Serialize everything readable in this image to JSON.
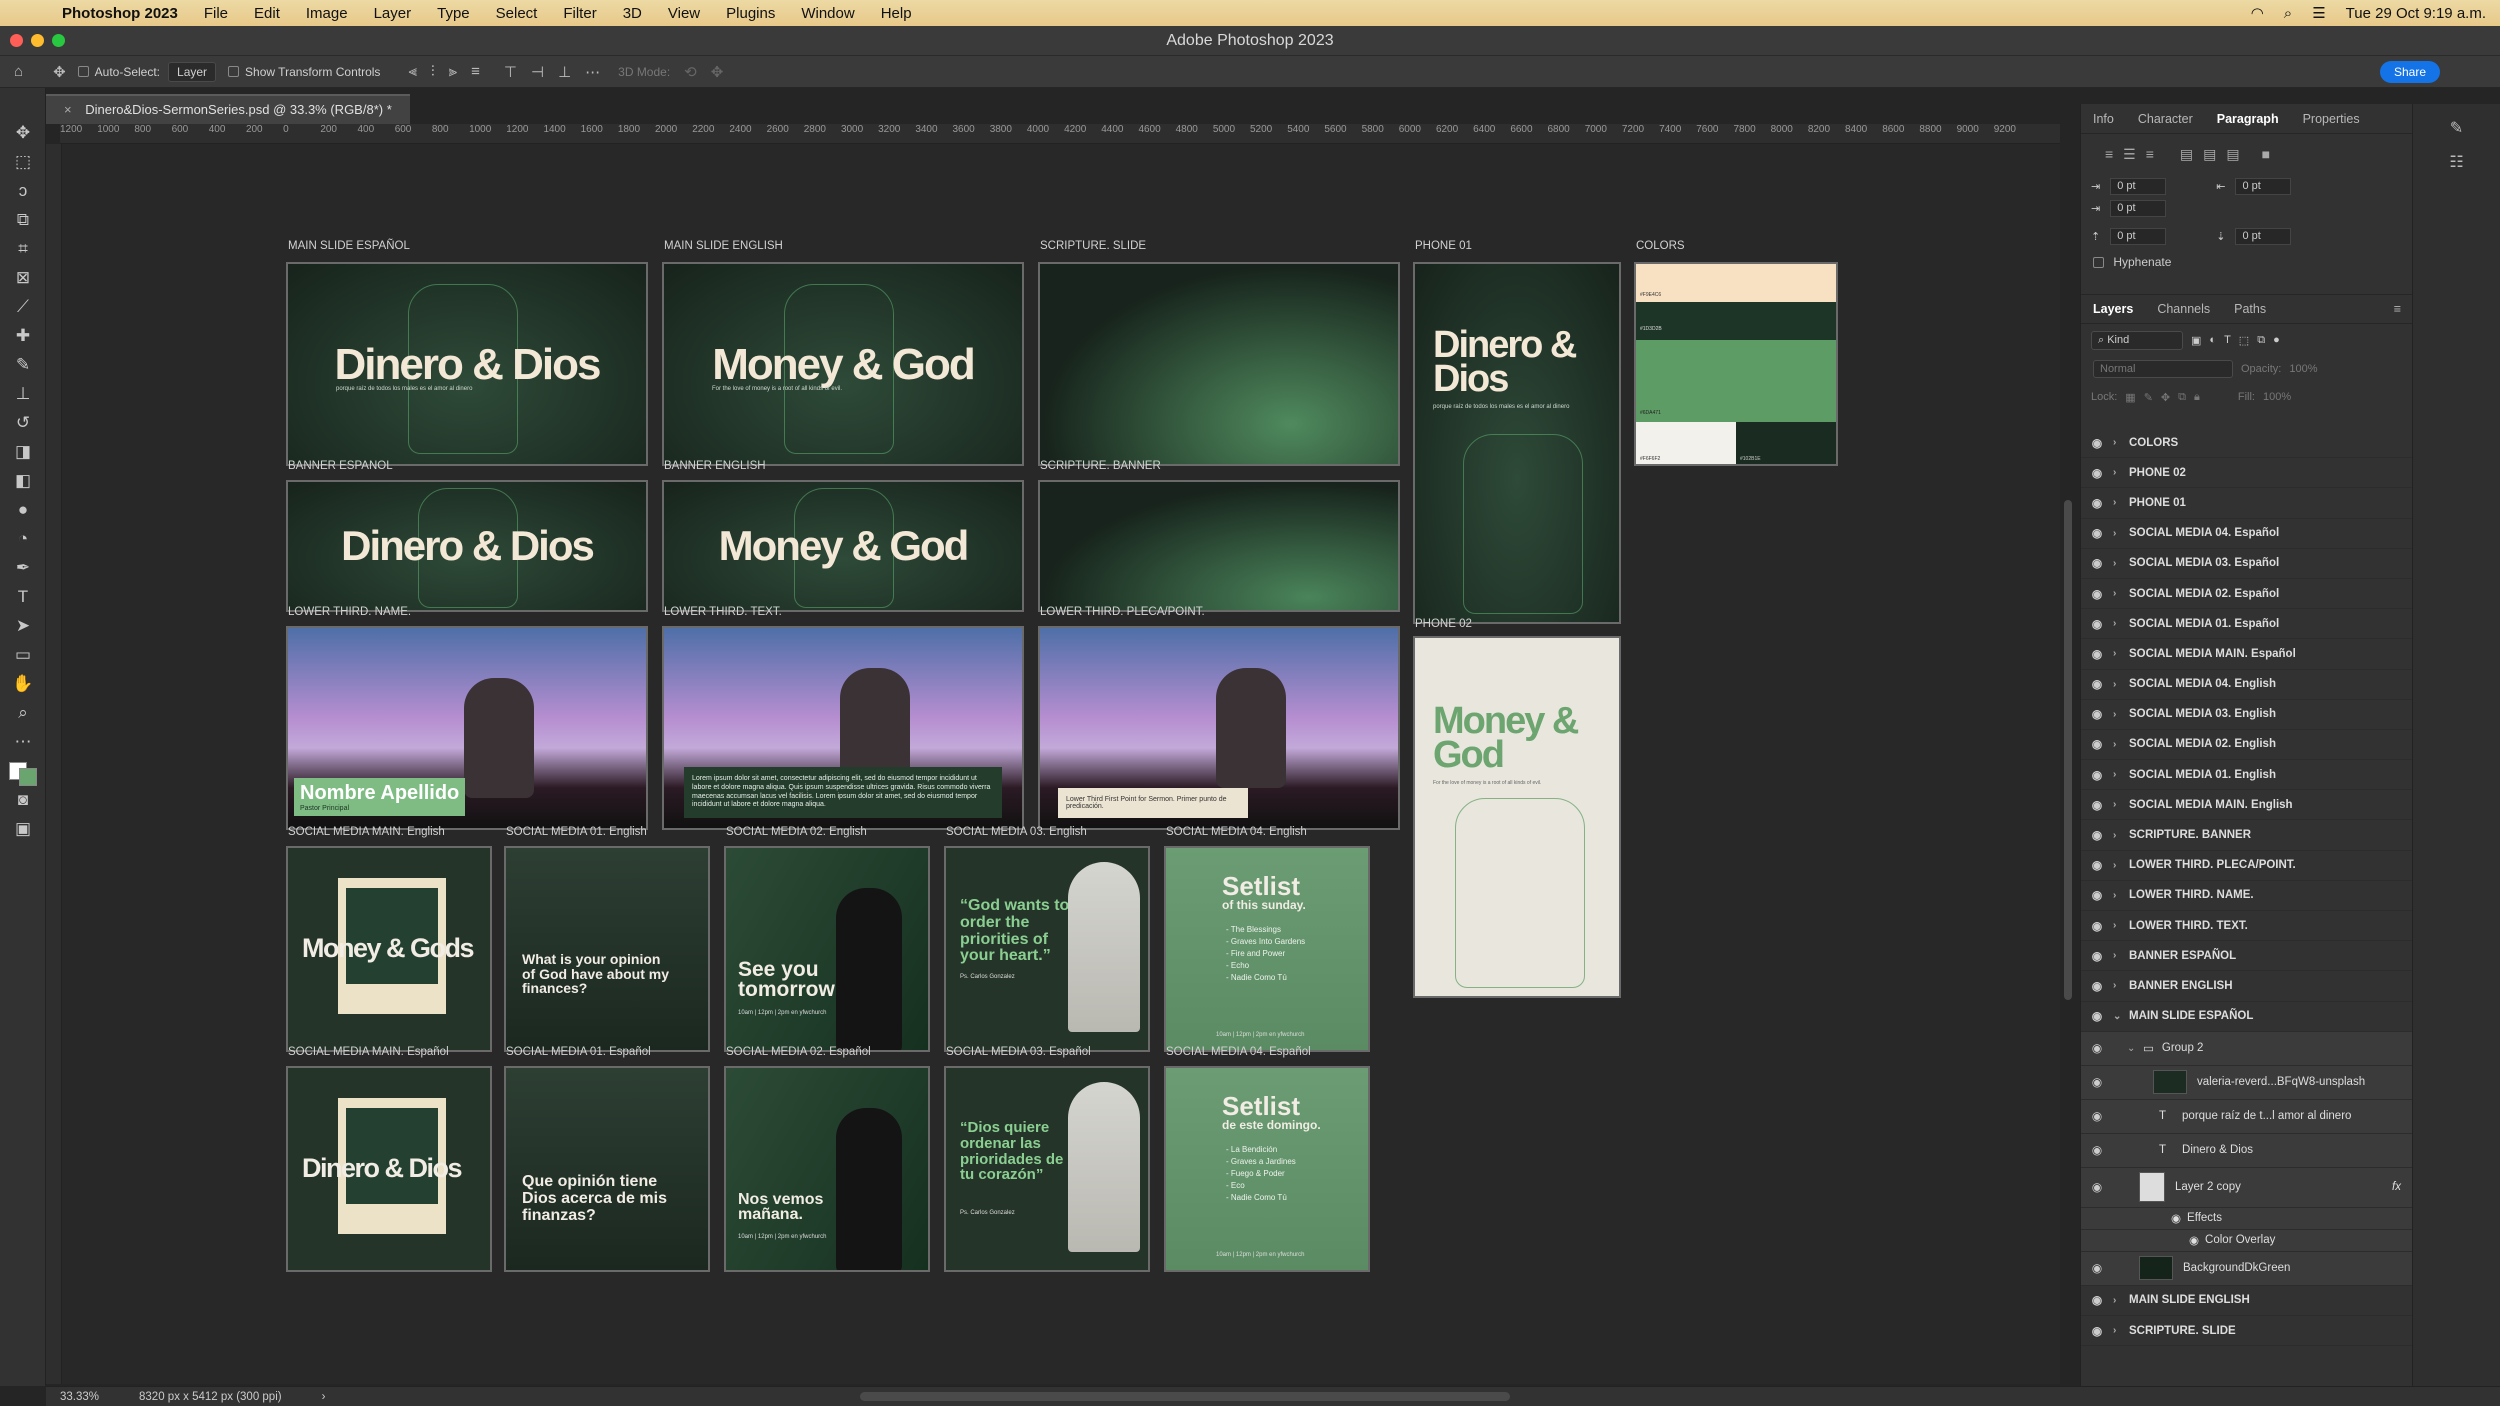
{
  "menubar": {
    "app": "Photoshop 2023",
    "items": [
      "File",
      "Edit",
      "Image",
      "Layer",
      "Type",
      "Select",
      "Filter",
      "3D",
      "View",
      "Plugins",
      "Window",
      "Help"
    ],
    "datetime": "Tue 29 Oct  9:19 a.m."
  },
  "window": {
    "title": "Adobe Photoshop 2023"
  },
  "options": {
    "auto_select_label": "Auto-Select:",
    "auto_select_value": "Layer",
    "show_transform": "Show Transform Controls",
    "mode_3d": "3D Mode:",
    "share": "Share"
  },
  "document": {
    "tab": "Dinero&Dios-SermonSeries.psd @ 33.3% (RGB/8*) *",
    "zoom": "33.33%",
    "dimensions": "8320 px x 5412 px (300 ppi)"
  },
  "ruler": [
    "1200",
    "1000",
    "800",
    "600",
    "400",
    "200",
    "0",
    "200",
    "400",
    "600",
    "800",
    "1000",
    "1200",
    "1400",
    "1600",
    "1800",
    "2000",
    "2200",
    "2400",
    "2600",
    "2800",
    "3000",
    "3200",
    "3400",
    "3600",
    "3800",
    "4000",
    "4200",
    "4400",
    "4600",
    "4800",
    "5000",
    "5200",
    "5400",
    "5600",
    "5800",
    "6000",
    "6200",
    "6400",
    "6600",
    "6800",
    "7000",
    "7200",
    "7400",
    "7600",
    "7800",
    "8000",
    "8200",
    "8400",
    "8600",
    "8800",
    "9000",
    "9200"
  ],
  "artboards": {
    "main_es": {
      "label": "MAIN SLIDE ESPAÑOL",
      "title": "Dinero & Dios",
      "sub": "porque raíz de todos los males es el amor al dinero"
    },
    "main_en": {
      "label": "MAIN SLIDE ENGLISH",
      "title": "Money & God",
      "sub": "For the love of money is a root of all kinds of evil."
    },
    "scripture_slide": {
      "label": "SCRIPTURE. SLIDE"
    },
    "phone01": {
      "label": "PHONE 01",
      "title": "Dinero & Dios",
      "sub": "porque raíz de todos los males es el amor al dinero"
    },
    "colors": {
      "label": "COLORS",
      "swatches": [
        {
          "name": "#F9E4C6",
          "hex": "#f8e0c2"
        },
        {
          "name": "#1D3D2B",
          "hex": "#1d3526"
        },
        {
          "name": "#6DA471",
          "hex": "#5e9c65"
        },
        {
          "name": "#F6F6F2",
          "hex": "#f2f1ec"
        },
        {
          "name": "#102B1E",
          "hex": "#1a2c21"
        }
      ]
    },
    "banner_es": {
      "label": "BANNER ESPANOL",
      "title": "Dinero & Dios"
    },
    "banner_en": {
      "label": "BANNER ENGLISH",
      "title": "Money & God"
    },
    "scripture_banner": {
      "label": "SCRIPTURE. BANNER"
    },
    "phone02": {
      "label": "PHONE 02",
      "title": "Money & God",
      "sub": "For the love of money is a root of all kinds of evil."
    },
    "lt_name": {
      "label": "LOWER THIRD. NAME.",
      "name": "Nombre Apellido",
      "role": "Pastor Principal"
    },
    "lt_text": {
      "label": "LOWER THIRD. TEXT.",
      "text": "Lorem ipsum dolor sit amet, consectetur adipiscing elit, sed do eiusmod tempor incididunt ut labore et dolore magna aliqua. Quis ipsum suspendisse ultrices gravida. Risus commodo viverra maecenas accumsan lacus vel facilisis. Lorem ipsum dolor sit amet, sed do eiusmod tempor incididunt ut labore et dolore magna aliqua."
    },
    "lt_placa": {
      "label": "LOWER THIRD. PLECA/POINT.",
      "text": "Lower Third First Point for Sermon. Primer punto de predicación."
    },
    "sm_main_en": {
      "label": "SOCIAL MEDIA MAIN. English",
      "title": "Money & Gods"
    },
    "sm01_en": {
      "label": "SOCIAL MEDIA 01. English",
      "title": "What is your opinion of God have about my finances?"
    },
    "sm02_en": {
      "label": "SOCIAL MEDIA 02. English",
      "title": "See you tomorrow",
      "sub": "10am | 12pm | 2pm en yfwchurch"
    },
    "sm03_en": {
      "label": "SOCIAL MEDIA 03. English",
      "title": "“God wants to order the priorities of your heart.”",
      "sub": "Ps. Carlos Gonzalez"
    },
    "sm04_en": {
      "label": "SOCIAL MEDIA 04. English",
      "title": "Setlist",
      "subtitle": "of this sunday.",
      "items": [
        "- The Blessings",
        "- Graves Into Gardens",
        "- Fire and Power",
        "- Echo",
        "- Nadie Como Tú"
      ],
      "foot": "10am | 12pm | 2pm en yfwchurch"
    },
    "sm_main_es": {
      "label": "SOCIAL MEDIA MAIN. Español",
      "title": "Dinero & Dios"
    },
    "sm01_es": {
      "label": "SOCIAL MEDIA 01. Español",
      "title": "Que opinión tiene Dios acerca de mis finanzas?"
    },
    "sm02_es": {
      "label": "SOCIAL MEDIA 02. Español",
      "title": "Nos vemos mañana.",
      "sub": "10am | 12pm | 2pm en yfwchurch"
    },
    "sm03_es": {
      "label": "SOCIAL MEDIA 03. Español",
      "title": "“Dios quiere ordenar las prioridades de tu corazón”",
      "sub": "Ps. Carlos Gonzalez"
    },
    "sm04_es": {
      "label": "SOCIAL MEDIA 04. Español",
      "title": "Setlist",
      "subtitle": "de este domingo.",
      "items": [
        "- La Bendición",
        "- Graves a Jardines",
        "- Fuego & Poder",
        "- Eco",
        "- Nadie Como Tú"
      ],
      "foot": "10am | 12pm | 2pm en yfwchurch"
    }
  },
  "panel": {
    "tabs": [
      "Info",
      "Character",
      "Paragraph",
      "Properties"
    ],
    "fields": [
      "0 pt",
      "0 pt",
      "0 pt",
      "0 pt",
      "0 pt"
    ],
    "hyphenate": "Hyphenate",
    "layer_tabs": [
      "Layers",
      "Channels",
      "Paths"
    ],
    "kind": "Kind",
    "blend": "Normal",
    "opacity_label": "Opacity:",
    "opacity": "100%",
    "lock_label": "Lock:",
    "fill_label": "Fill:",
    "fill": "100%",
    "layers": [
      "COLORS",
      "PHONE 02",
      "PHONE 01",
      "SOCIAL MEDIA 04. Español",
      "SOCIAL MEDIA 03. Español",
      "SOCIAL MEDIA 02. Español",
      "SOCIAL MEDIA 01. Español",
      "SOCIAL MEDIA MAIN. Español",
      "SOCIAL MEDIA 04. English",
      "SOCIAL MEDIA 03. English",
      "SOCIAL MEDIA 02. English",
      "SOCIAL MEDIA 01. English",
      "SOCIAL MEDIA MAIN. English",
      "SCRIPTURE. BANNER",
      "LOWER THIRD. PLECA/POINT.",
      "LOWER THIRD. NAME.",
      "LOWER THIRD. TEXT.",
      "BANNER ESPAÑOL",
      "BANNER ENGLISH",
      "MAIN SLIDE ESPAÑOL"
    ],
    "group": "Group 2",
    "sublayers": [
      "valeria-reverd...BFqW8-unsplash",
      "porque raíz de t...l amor al dinero",
      "Dinero & Dios",
      "Layer 2 copy"
    ],
    "effects": "Effects",
    "color_overlay": "Color Overlay",
    "bg_layer": "BackgroundDkGreen",
    "after": [
      "MAIN SLIDE ENGLISH",
      "SCRIPTURE. SLIDE"
    ]
  }
}
